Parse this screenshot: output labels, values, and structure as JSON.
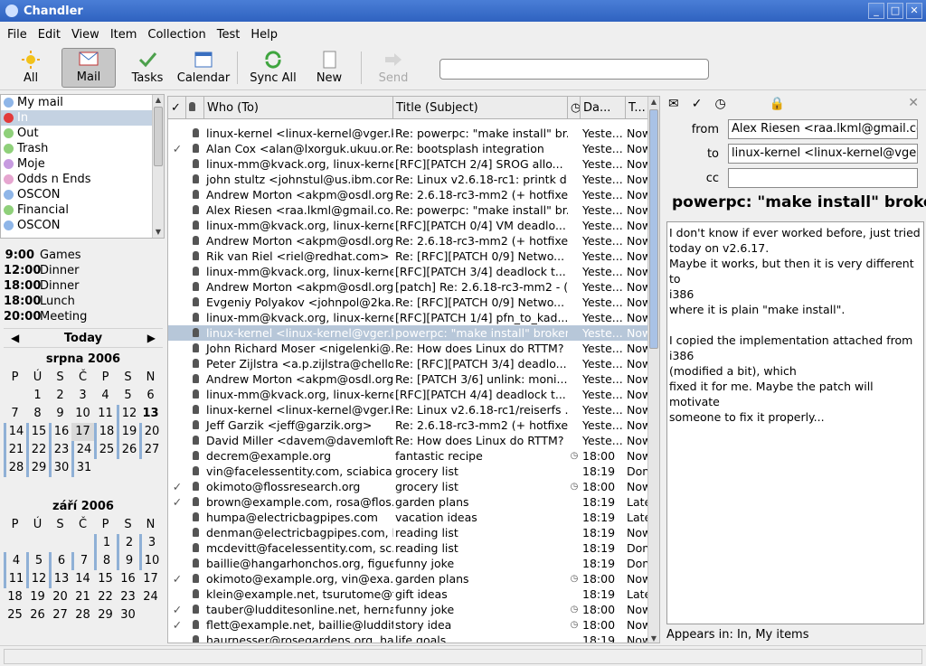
{
  "window": {
    "title": "Chandler"
  },
  "menu": [
    "File",
    "Edit",
    "View",
    "Item",
    "Collection",
    "Test",
    "Help"
  ],
  "toolbar": {
    "all": "All",
    "mail": "Mail",
    "tasks": "Tasks",
    "calendar": "Calendar",
    "sync_all": "Sync All",
    "new": "New",
    "send": "Send",
    "search_value": ""
  },
  "collections": [
    {
      "label": "My mail",
      "color": "#8fb6e8"
    },
    {
      "label": "In",
      "color": "#e23a3a",
      "selected": true
    },
    {
      "label": "Out",
      "color": "#8fd07a"
    },
    {
      "label": "Trash",
      "color": "#8fd07a"
    },
    {
      "label": "Moje",
      "color": "#c79be0"
    },
    {
      "label": "Odds n Ends",
      "color": "#e6a6d0"
    },
    {
      "label": "OSCON",
      "color": "#8fb6e8"
    },
    {
      "label": "Financial",
      "color": "#8fd07a"
    },
    {
      "label": "OSCON",
      "color": "#8fb6e8"
    }
  ],
  "events": [
    {
      "time": "9:00",
      "title": "Games"
    },
    {
      "time": "12:00",
      "title": "Dinner"
    },
    {
      "time": "18:00",
      "title": "Dinner"
    },
    {
      "time": "18:00",
      "title": "Lunch"
    },
    {
      "time": "20:00",
      "title": "Meeting"
    }
  ],
  "calendar": {
    "today_label": "Today",
    "prev": "◀",
    "next": "▶",
    "weekdays": [
      "P",
      "Ú",
      "S",
      "Č",
      "P",
      "S",
      "N"
    ],
    "months": [
      {
        "title": "srpna 2006",
        "weeks": [
          [
            "",
            "1",
            "2",
            "3",
            "4",
            "5",
            "6"
          ],
          [
            "7",
            "8",
            "9",
            "10",
            "11",
            "12",
            "13"
          ],
          [
            "14",
            "15",
            "16",
            "17",
            "18",
            "19",
            "20"
          ],
          [
            "21",
            "22",
            "23",
            "24",
            "25",
            "26",
            "27"
          ],
          [
            "28",
            "29",
            "30",
            "31",
            "",
            "",
            ""
          ]
        ]
      },
      {
        "title": "září 2006",
        "weeks": [
          [
            "",
            "",
            "",
            "",
            "1",
            "2",
            "3"
          ],
          [
            "4",
            "5",
            "6",
            "7",
            "8",
            "9",
            "10"
          ],
          [
            "11",
            "12",
            "13",
            "14",
            "15",
            "16",
            "17"
          ],
          [
            "18",
            "19",
            "20",
            "21",
            "22",
            "23",
            "24"
          ],
          [
            "25",
            "26",
            "27",
            "28",
            "29",
            "30",
            ""
          ]
        ]
      }
    ]
  },
  "table": {
    "headers": {
      "who": "Who (To)",
      "title": "Title (Subject)",
      "date": "Da...",
      "triage": "T..."
    },
    "rows": [
      {
        "check": "",
        "who": "linux-kernel <linux-kernel@vger.k...",
        "title": "Re: powerpc: \"make install\" br...",
        "clock": "",
        "date": "Yeste...",
        "tri": "Now"
      },
      {
        "check": "✓",
        "who": "Alan Cox <alan@lxorguk.ukuu.or...",
        "title": "Re: bootsplash integration",
        "clock": "",
        "date": "Yeste...",
        "tri": "Now"
      },
      {
        "check": "",
        "who": "linux-mm@kvack.org, linux-kerne...",
        "title": "[RFC][PATCH 2/4] SROG allo...",
        "clock": "",
        "date": "Yeste...",
        "tri": "Now"
      },
      {
        "check": "",
        "who": "john stultz <johnstul@us.ibm.cor...",
        "title": "Re: Linux v2.6.18-rc1: printk d...",
        "clock": "",
        "date": "Yeste...",
        "tri": "Now"
      },
      {
        "check": "",
        "who": "Andrew Morton <akpm@osdl.org>",
        "title": "Re: 2.6.18-rc3-mm2 (+ hotfixe...",
        "clock": "",
        "date": "Yeste...",
        "tri": "Now"
      },
      {
        "check": "",
        "who": "Alex Riesen <raa.lkml@gmail.co...",
        "title": "Re: powerpc: \"make install\" br...",
        "clock": "",
        "date": "Yeste...",
        "tri": "Now"
      },
      {
        "check": "",
        "who": "linux-mm@kvack.org, linux-kerne...",
        "title": "[RFC][PATCH 0/4] VM deadlo...",
        "clock": "",
        "date": "Yeste...",
        "tri": "Now"
      },
      {
        "check": "",
        "who": "Andrew Morton <akpm@osdl.org>",
        "title": "Re: 2.6.18-rc3-mm2 (+ hotfixe...",
        "clock": "",
        "date": "Yeste...",
        "tri": "Now"
      },
      {
        "check": "",
        "who": "Rik van Riel <riel@redhat.com>",
        "title": "Re: [RFC][PATCH 0/9] Netwo...",
        "clock": "",
        "date": "Yeste...",
        "tri": "Now"
      },
      {
        "check": "",
        "who": "linux-mm@kvack.org, linux-kerne...",
        "title": "[RFC][PATCH 3/4] deadlock t...",
        "clock": "",
        "date": "Yeste...",
        "tri": "Now"
      },
      {
        "check": "",
        "who": "Andrew Morton <akpm@osdl.org>",
        "title": "[patch] Re: 2.6.18-rc3-mm2 - (...",
        "clock": "",
        "date": "Yeste...",
        "tri": "Now"
      },
      {
        "check": "",
        "who": "Evgeniy Polyakov <johnpol@2ka...",
        "title": "Re: [RFC][PATCH 0/9] Netwo...",
        "clock": "",
        "date": "Yeste...",
        "tri": "Now"
      },
      {
        "check": "",
        "who": "linux-mm@kvack.org, linux-kerne...",
        "title": "[RFC][PATCH 1/4] pfn_to_kad...",
        "clock": "",
        "date": "Yeste...",
        "tri": "Now"
      },
      {
        "check": "",
        "who": "linux-kernel <linux-kernel@vger.k...",
        "title": "powerpc: \"make install\" broken",
        "clock": "",
        "date": "Yeste...",
        "tri": "Now",
        "selected": true
      },
      {
        "check": "",
        "who": "John Richard Moser <nigelenki@...",
        "title": "Re: How does Linux do RTTM?",
        "clock": "",
        "date": "Yeste...",
        "tri": "Now"
      },
      {
        "check": "",
        "who": "Peter Zijlstra <a.p.zijlstra@chello...",
        "title": "Re: [RFC][PATCH 3/4] deadlo...",
        "clock": "",
        "date": "Yeste...",
        "tri": "Now"
      },
      {
        "check": "",
        "who": "Andrew Morton <akpm@osdl.org>",
        "title": "Re: [PATCH 3/6] unlink: moni...",
        "clock": "",
        "date": "Yeste...",
        "tri": "Now"
      },
      {
        "check": "",
        "who": "linux-mm@kvack.org, linux-kerne...",
        "title": "[RFC][PATCH 4/4] deadlock t...",
        "clock": "",
        "date": "Yeste...",
        "tri": "Now"
      },
      {
        "check": "",
        "who": "linux-kernel <linux-kernel@vger.k...",
        "title": "Re: Linux v2.6.18-rc1/reiserfs ...",
        "clock": "",
        "date": "Yeste...",
        "tri": "Now"
      },
      {
        "check": "",
        "who": "Jeff Garzik <jeff@garzik.org>",
        "title": "Re: 2.6.18-rc3-mm2 (+ hotfixe...",
        "clock": "",
        "date": "Yeste...",
        "tri": "Now"
      },
      {
        "check": "",
        "who": "David Miller <davem@davemloft....",
        "title": "Re: How does Linux do RTTM?",
        "clock": "",
        "date": "Yeste...",
        "tri": "Now"
      },
      {
        "check": "",
        "who": "decrem@example.org",
        "title": "fantastic recipe",
        "clock": "◷",
        "date": "18:00",
        "tri": "Now"
      },
      {
        "check": "",
        "who": "vin@facelessentity.com, sciabica...",
        "title": "grocery list",
        "clock": "",
        "date": "18:19",
        "tri": "Done"
      },
      {
        "check": "✓",
        "who": "okimoto@flossresearch.org",
        "title": "grocery list",
        "clock": "◷",
        "date": "18:00",
        "tri": "Now"
      },
      {
        "check": "✓",
        "who": "brown@example.com, rosa@flos...",
        "title": "garden plans",
        "clock": "",
        "date": "18:19",
        "tri": "Later"
      },
      {
        "check": "",
        "who": "humpa@electricbagpipes.com",
        "title": "vacation ideas",
        "clock": "",
        "date": "18:19",
        "tri": "Later"
      },
      {
        "check": "",
        "who": "denman@electricbagpipes.com, b...",
        "title": "reading list",
        "clock": "",
        "date": "18:19",
        "tri": "Now"
      },
      {
        "check": "",
        "who": "mcdevitt@facelessentity.com, sc...",
        "title": "reading list",
        "clock": "",
        "date": "18:19",
        "tri": "Done"
      },
      {
        "check": "",
        "who": "baillie@hangarhonchos.org, figue...",
        "title": "funny joke",
        "clock": "",
        "date": "18:19",
        "tri": "Done"
      },
      {
        "check": "✓",
        "who": "okimoto@example.org, vin@exa...",
        "title": "garden plans",
        "clock": "◷",
        "date": "18:00",
        "tri": "Now"
      },
      {
        "check": "",
        "who": "klein@example.net, tsurutome@f...",
        "title": "gift ideas",
        "clock": "",
        "date": "18:19",
        "tri": "Late"
      },
      {
        "check": "✓",
        "who": "tauber@ludditesonline.net, hernai...",
        "title": "funny joke",
        "clock": "◷",
        "date": "18:00",
        "tri": "Now"
      },
      {
        "check": "✓",
        "who": "flett@example.net, baillie@luddit...",
        "title": "story idea",
        "clock": "◷",
        "date": "18:00",
        "tri": "Now"
      },
      {
        "check": "",
        "who": "haurnesser@rosegardens.org, ha...",
        "title": "life goals",
        "clock": "",
        "date": "18:19",
        "tri": "Now"
      }
    ]
  },
  "detail": {
    "from_label": "from",
    "from_value": "Alex Riesen <raa.lkml@gmail.com>",
    "to_label": "to",
    "to_value": "linux-kernel <linux-kernel@vger.kernel.org>",
    "cc_label": "cc",
    "cc_value": "",
    "subject": "powerpc: \"make install\" broken",
    "body": "I don't know if ever worked before, just tried\ntoday on v2.6.17.\nMaybe it works, but then it is very different to\ni386\nwhere it is plain \"make install\".\n\nI copied the implementation attached from i386\n(modified a bit), which\nfixed it for me. Maybe the patch will motivate\nsomeone to fix it properly...",
    "appears_in": "Appears in: In, My items"
  }
}
